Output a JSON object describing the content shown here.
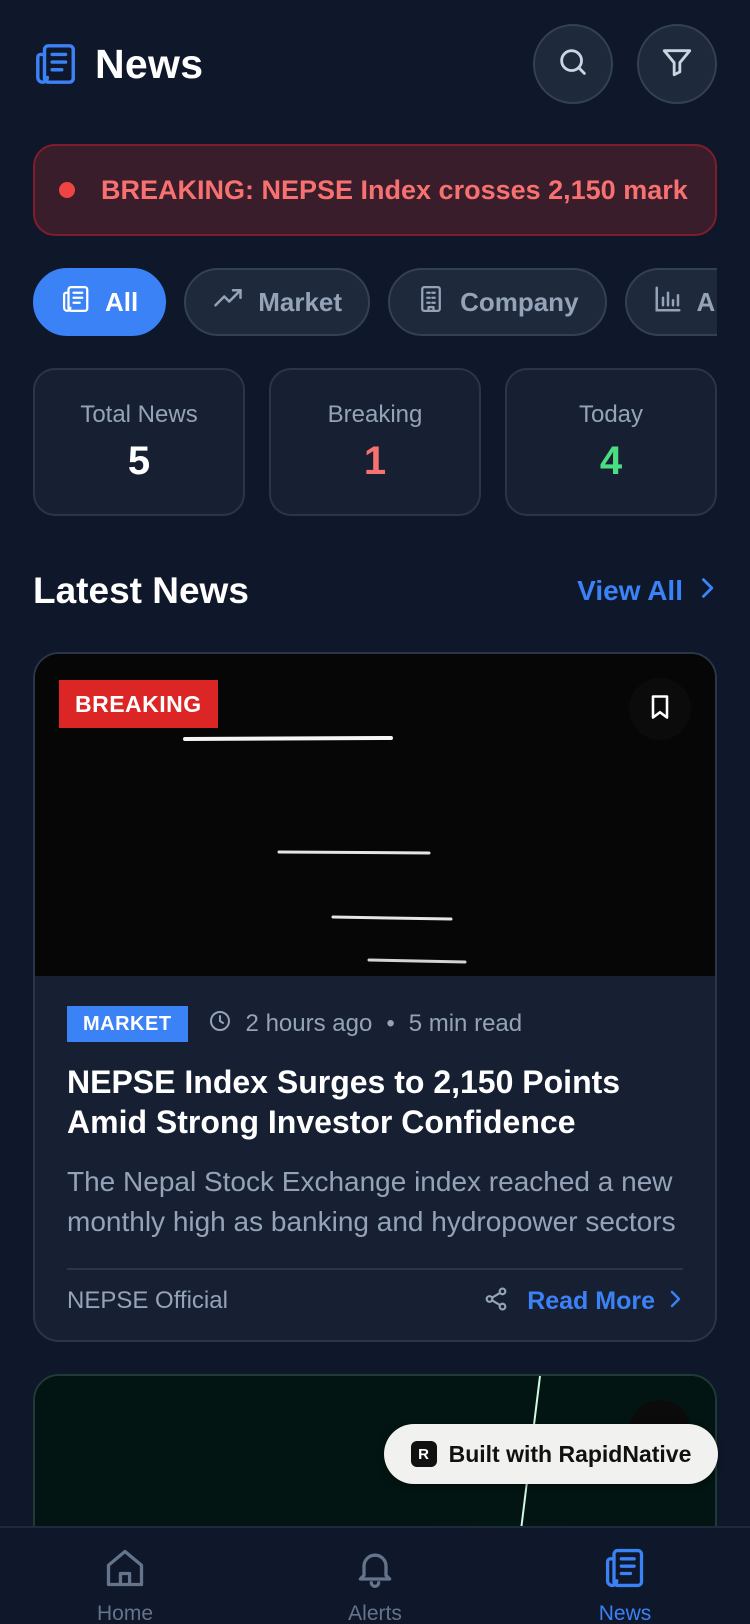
{
  "header": {
    "title": "News"
  },
  "ticker": {
    "text": "BREAKING: NEPSE Index crosses 2,150 mark"
  },
  "categories": [
    {
      "label": "All",
      "active": true,
      "icon": "newspaper-icon"
    },
    {
      "label": "Market",
      "active": false,
      "icon": "trending-up-icon"
    },
    {
      "label": "Company",
      "active": false,
      "icon": "building-icon"
    },
    {
      "label": "Analysis",
      "active": false,
      "icon": "bar-chart-icon"
    }
  ],
  "stats": [
    {
      "label": "Total News",
      "value": "5",
      "color": "#ffffff"
    },
    {
      "label": "Breaking",
      "value": "1",
      "color": "#f87171"
    },
    {
      "label": "Today",
      "value": "4",
      "color": "#4ade80"
    }
  ],
  "section": {
    "title": "Latest News",
    "view_all": "View All"
  },
  "featured": {
    "badge": "BREAKING",
    "tag": "MARKET",
    "time": "2 hours ago",
    "read_time": "5 min read",
    "title": "NEPSE Index Surges to 2,150 Points Amid Strong Investor Confidence",
    "excerpt": "The Nepal Stock Exchange index reached a new monthly high as banking and hydropower sectors led the gains.",
    "source": "NEPSE Official",
    "read_more": "Read More"
  },
  "built_with": "Built with RapidNative",
  "nav": [
    {
      "label": "Home",
      "active": false,
      "icon": "home-icon"
    },
    {
      "label": "Alerts",
      "active": false,
      "icon": "bell-icon"
    },
    {
      "label": "News",
      "active": true,
      "icon": "newspaper-icon"
    }
  ],
  "colors": {
    "accent": "#3b82f6",
    "breaking": "#dc2626",
    "background": "#0f172a"
  }
}
